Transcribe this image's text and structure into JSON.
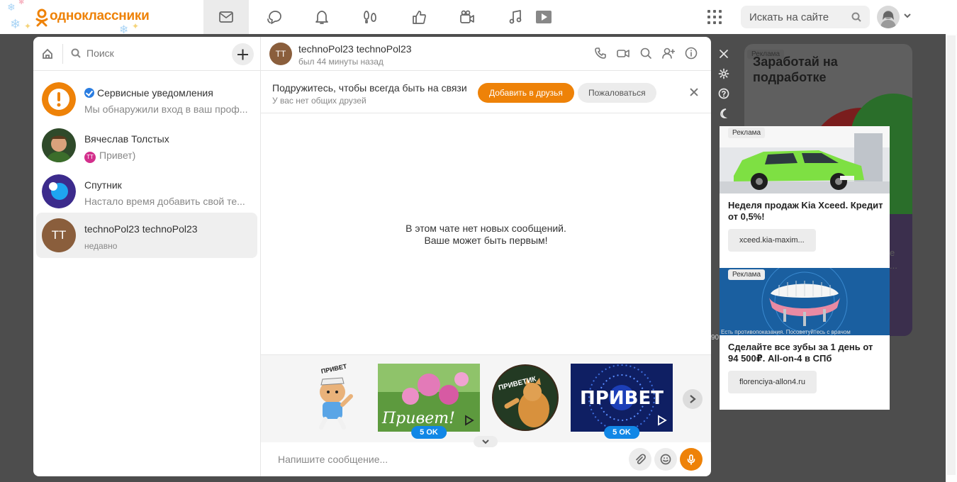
{
  "header": {
    "logo_text": "одноклассники",
    "search_placeholder": "Искать на сайте",
    "nav": [
      "messages-icon",
      "discussions-icon",
      "notifications-icon",
      "guests-icon",
      "likes-icon",
      "video-icon",
      "music-icon",
      "video-play-icon"
    ]
  },
  "left_panel": {
    "search_label": "Поиск",
    "chats": [
      {
        "name": "Сервисные уведомления",
        "preview": "Мы обнаружили вход в ваш проф...",
        "verified": true
      },
      {
        "name": "Вячеслав Толстых",
        "preview": "Привет)",
        "mini_avatar": "TT"
      },
      {
        "name": "Спутник",
        "preview": "Настало время добавить свой те..."
      },
      {
        "name": "technoPol23 technoPol23",
        "preview": "недавно",
        "initials": "TT",
        "active": true
      }
    ]
  },
  "chat": {
    "title": "technoPol23 technoPol23",
    "status": "был 44 минуты назад",
    "avatar_initials": "TT",
    "friend_prompt": "Подружитесь, чтобы всегда быть на связи",
    "friend_sub": "У вас нет общих друзей",
    "add_friend_label": "Добавить в друзья",
    "report_label": "Пожаловаться",
    "empty_line1": "В этом чате нет новых сообщений.",
    "empty_line2": "Ваше может быть первым!",
    "stickers": [
      {
        "caption": "ПРИВЕТ",
        "price": ""
      },
      {
        "caption": "Привет!",
        "price": "5 OK"
      },
      {
        "caption": "ПРИВЕТИК",
        "price": ""
      },
      {
        "caption": "ПРИВЕТ",
        "price": "5 OK"
      }
    ],
    "composer_placeholder": "Напишите сообщение..."
  },
  "ads": {
    "bg_title": "Заработай на подработке",
    "bg_badge": "Реклама",
    "bg_fragment_1": "е",
    "bg_fragment_2": "...",
    "side_fragment": "90",
    "card1": {
      "badge": "Реклама",
      "title": "Неделя продаж Kia Xceed. Кредит от 0,5%!",
      "link": "xceed.kia-maxim..."
    },
    "card2": {
      "badge": "Реклама",
      "title": "Сделайте все зубы за 1 день от 94 500₽. All-on-4 в СПб",
      "link": "florenciya-allon4.ru",
      "warning": "Есть противопоказания. Посоветуйтесь с врачом"
    }
  },
  "colors": {
    "brand_orange": "#ee8208",
    "accent_blue": "#1187e6",
    "overlay": "#4d4d4d"
  }
}
